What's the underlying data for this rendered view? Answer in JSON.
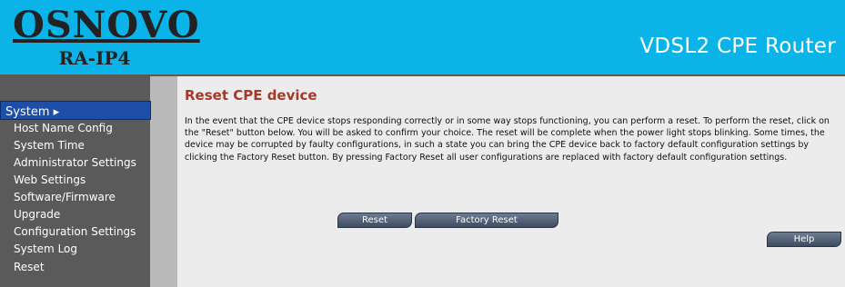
{
  "header": {
    "brand": "OSNOVO",
    "model": "RA-IP4",
    "product_title": "VDSL2 CPE Router"
  },
  "sidebar": {
    "active_section": "System ▸",
    "items": [
      "Host Name Config",
      "System Time",
      "Administrator Settings",
      "Web Settings",
      "Software/Firmware",
      "Upgrade",
      "Configuration Settings",
      "System Log",
      "Reset"
    ]
  },
  "main": {
    "title": "Reset CPE device",
    "description": "In the event that the CPE device stops responding correctly or in some way stops functioning, you can perform a reset. To perform the reset, click on the \"Reset\" button below. You will be asked to confirm your choice. The reset will be complete when the power light stops blinking. Some times, the device may be corrupted by faulty configurations, in such a state you can bring the CPE device back to factory default configuration settings by clicking the Factory Reset button. By pressing Factory Reset all user configurations are replaced with factory default configuration settings.",
    "reset_label": "Reset",
    "factory_reset_label": "Factory Reset",
    "help_label": "Help"
  },
  "colors": {
    "header_bg": "#0ab4e8",
    "sidebar_bg": "#5a5a5a",
    "sidebar_active": "#1e4fa8",
    "title_color": "#a53a2a"
  }
}
